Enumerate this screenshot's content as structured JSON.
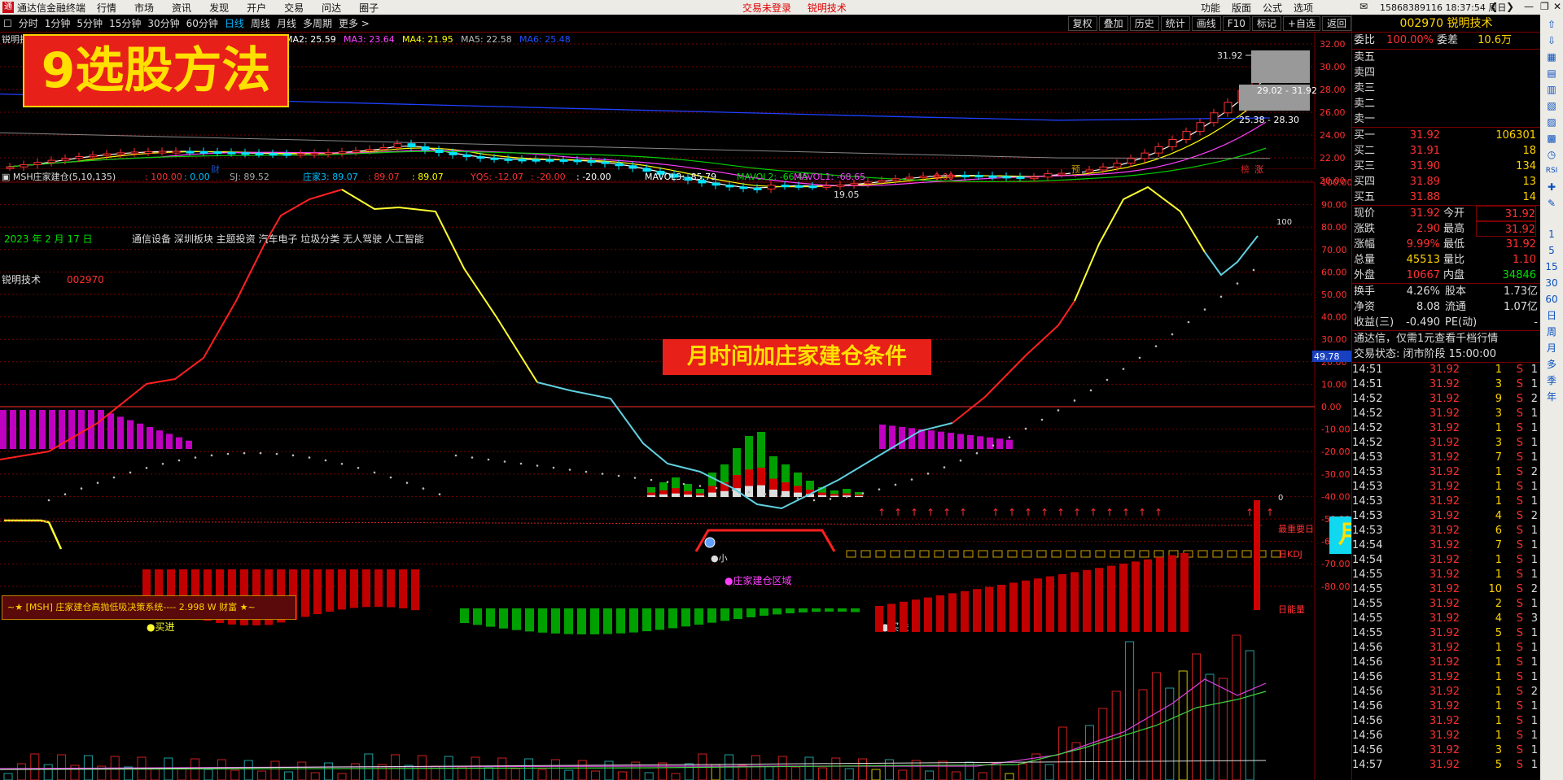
{
  "menubar": {
    "app_name": "通达信金融终端",
    "items": [
      "行情",
      "市场",
      "资讯",
      "发现",
      "开户",
      "交易",
      "问达",
      "圈子"
    ],
    "center_items": [
      "交易未登录",
      "锐明技术"
    ],
    "right_items": [
      "功能",
      "版面",
      "公式",
      "选项"
    ],
    "phone_time": "15868389116 18:37:54 周日"
  },
  "toolbar": {
    "periods": [
      "分时",
      "1分钟",
      "5分钟",
      "15分钟",
      "30分钟",
      "60分钟",
      "日线",
      "周线",
      "月线",
      "多周期",
      "更多 >"
    ],
    "active_period": "日线",
    "right_buttons": [
      "复权",
      "叠加",
      "历史",
      "统计",
      "画线",
      "F10",
      "标记",
      "+自选",
      "返回"
    ]
  },
  "main_chart": {
    "stock_label": "锐明技术",
    "ma_legend": [
      {
        "text": "MA2: 25.59",
        "color": "#ffffff"
      },
      {
        "text": "MA3: 23.64",
        "color": "#ff40ff"
      },
      {
        "text": "MA4: 21.95",
        "color": "#ffff00"
      },
      {
        "text": "MA5: 22.58",
        "color": "#bbbbbb"
      },
      {
        "text": "MA6: 25.48",
        "color": "#2050ff"
      }
    ],
    "y_ticks": [
      "32.00",
      "30.00",
      "28.00",
      "26.00",
      "24.00",
      "22.00",
      "20.00"
    ],
    "high_label": "31.92",
    "low_label": "19.05",
    "box1_label": "29.02 - 31.92",
    "box2_label": "25.38 - 28.30",
    "markers": [
      "财",
      "预",
      "榜",
      "涨"
    ]
  },
  "indicator_bar": {
    "name": "MSH庄家建仓(5,10,135)",
    "values": [
      {
        "text": ": 100.00",
        "color": "#ff3030"
      },
      {
        "text": ": 0.00",
        "color": "#00c0ff"
      },
      {
        "text": "SJ: 89.52",
        "color": "#aaaaaa"
      },
      {
        "text": "庄家3: 89.07",
        "color": "#00c0ff"
      },
      {
        "text": ": 89.07",
        "color": "#ff3030"
      },
      {
        "text": ": 89.07",
        "color": "#ffff00"
      },
      {
        "text": "YQS: -12.07",
        "color": "#ff3030"
      },
      {
        "text": ": -20.00",
        "color": "#ff3030"
      },
      {
        "text": ": -20.00",
        "color": "#ffffff"
      },
      {
        "text": "MAVOL3: -85.79",
        "color": "#ffffff"
      },
      {
        "text": "MAVOL2: -66.45",
        "color": "#00e000"
      },
      {
        "text": "MAVOL1: -68.65",
        "color": "#ff40ff"
      },
      {
        "text": ": 0.00",
        "color": "#ff3030"
      }
    ]
  },
  "sub_chart": {
    "date": "2023 年 2 月 17 日",
    "sectors": "通信设备 深圳板块 主题投资 汽车电子 垃圾分类 无人驾驶 人工智能",
    "stock_name": "锐明技术",
    "stock_code": "002970",
    "y_ticks": [
      "100.00",
      "90.00",
      "80.00",
      "70.00",
      "60.00",
      "50.00",
      "40.00",
      "30.00",
      "20.00",
      "10.00",
      "0.00",
      "-10.00",
      "-20.00",
      "-30.00",
      "-40.00",
      "-50.00",
      "-60.00",
      "-70.00",
      "-80.00"
    ],
    "right_labels": [
      "100",
      "0",
      "最重要日",
      "日KDJ",
      "日能量"
    ],
    "current_value": "49.78",
    "zone_label": "●庄家建仓区域",
    "small_label": "●小",
    "buy_label": "●买进",
    "system_box": "~★ [MSH] 庄家建仓高抛低吸决策系统----  2.998 W   财富 ★~"
  },
  "banners": {
    "title": "9选股方法",
    "condition": "月时间加庄家建仓条件",
    "low": "月时间线低"
  },
  "quote": {
    "code_name": "002970 锐明技术",
    "ratio_label": "委比",
    "ratio_value": "100.00%",
    "diff_label": "委差",
    "diff_value": "10.6万",
    "sells": [
      "卖五",
      "卖四",
      "卖三",
      "卖二",
      "卖一"
    ],
    "buys": [
      {
        "label": "买一",
        "price": "31.92",
        "vol": "106301"
      },
      {
        "label": "买二",
        "price": "31.91",
        "vol": "18"
      },
      {
        "label": "买三",
        "price": "31.90",
        "vol": "134"
      },
      {
        "label": "买四",
        "price": "31.89",
        "vol": "13"
      },
      {
        "label": "买五",
        "price": "31.88",
        "vol": "14"
      }
    ],
    "stats": [
      {
        "l1": "现价",
        "v1": "31.92",
        "c1": "r",
        "l2": "今开",
        "v2": "31.92",
        "c2": "r",
        "box": true
      },
      {
        "l1": "涨跌",
        "v1": "2.90",
        "c1": "r",
        "l2": "最高",
        "v2": "31.92",
        "c2": "r",
        "box": true
      },
      {
        "l1": "涨幅",
        "v1": "9.99%",
        "c1": "r",
        "l2": "最低",
        "v2": "31.92",
        "c2": "r",
        "box": false
      },
      {
        "l1": "总量",
        "v1": "45513",
        "c1": "y",
        "l2": "量比",
        "v2": "1.10",
        "c2": "r",
        "box": false
      },
      {
        "l1": "外盘",
        "v1": "10667",
        "c1": "r",
        "l2": "内盘",
        "v2": "34846",
        "c2": "g",
        "box": false
      }
    ],
    "stats2": [
      {
        "l1": "换手",
        "v1": "4.26%",
        "l2": "股本",
        "v2": "1.73亿"
      },
      {
        "l1": "净资",
        "v1": "8.08",
        "l2": "流通",
        "v2": "1.07亿"
      },
      {
        "l1": "收益(三)",
        "v1": "-0.490",
        "l2": "PE(动)",
        "v2": "-"
      }
    ],
    "notice": "通达信，仅需1元查看千档行情",
    "trade_status": "交易状态: 闭市阶段 15:00:00"
  },
  "ticks": [
    [
      "14:51",
      "31.92",
      "1",
      "S",
      "1"
    ],
    [
      "14:51",
      "31.92",
      "3",
      "S",
      "1"
    ],
    [
      "14:52",
      "31.92",
      "9",
      "S",
      "2"
    ],
    [
      "14:52",
      "31.92",
      "3",
      "S",
      "1"
    ],
    [
      "14:52",
      "31.92",
      "1",
      "S",
      "1"
    ],
    [
      "14:52",
      "31.92",
      "3",
      "S",
      "1"
    ],
    [
      "14:53",
      "31.92",
      "7",
      "S",
      "1"
    ],
    [
      "14:53",
      "31.92",
      "1",
      "S",
      "2"
    ],
    [
      "14:53",
      "31.92",
      "1",
      "S",
      "1"
    ],
    [
      "14:53",
      "31.92",
      "1",
      "S",
      "1"
    ],
    [
      "14:53",
      "31.92",
      "4",
      "S",
      "2"
    ],
    [
      "14:53",
      "31.92",
      "6",
      "S",
      "1"
    ],
    [
      "14:54",
      "31.92",
      "7",
      "S",
      "1"
    ],
    [
      "14:54",
      "31.92",
      "1",
      "S",
      "1"
    ],
    [
      "14:55",
      "31.92",
      "1",
      "S",
      "1"
    ],
    [
      "14:55",
      "31.92",
      "10",
      "S",
      "2"
    ],
    [
      "14:55",
      "31.92",
      "2",
      "S",
      "1"
    ],
    [
      "14:55",
      "31.92",
      "4",
      "S",
      "3"
    ],
    [
      "14:55",
      "31.92",
      "5",
      "S",
      "1"
    ],
    [
      "14:56",
      "31.92",
      "1",
      "S",
      "1"
    ],
    [
      "14:56",
      "31.92",
      "1",
      "S",
      "1"
    ],
    [
      "14:56",
      "31.92",
      "1",
      "S",
      "1"
    ],
    [
      "14:56",
      "31.92",
      "1",
      "S",
      "2"
    ],
    [
      "14:56",
      "31.92",
      "1",
      "S",
      "1"
    ],
    [
      "14:56",
      "31.92",
      "1",
      "S",
      "1"
    ],
    [
      "14:56",
      "31.92",
      "1",
      "S",
      "1"
    ],
    [
      "14:56",
      "31.92",
      "3",
      "S",
      "1"
    ],
    [
      "14:57",
      "31.92",
      "5",
      "S",
      "1"
    ]
  ],
  "side_icons": [
    "1",
    "5",
    "15",
    "30",
    "60",
    "日",
    "周",
    "月",
    "多",
    "季",
    "年"
  ],
  "colors": {
    "up": "#ff3030",
    "down": "#00e5ff",
    "grid": "#7a0000",
    "accent": "#ffd400"
  }
}
